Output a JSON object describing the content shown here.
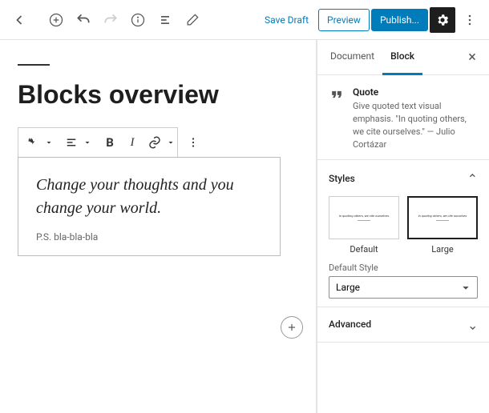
{
  "topbar": {
    "save_draft": "Save Draft",
    "preview": "Preview",
    "publish": "Publish..."
  },
  "editor": {
    "post_title": "Blocks overview",
    "quote": {
      "text": "Change your thoughts and you change your world.",
      "citation": "P.S. bla-bla-bla"
    },
    "toolbar": {
      "bold": "B",
      "italic": "I"
    }
  },
  "sidebar": {
    "tabs": {
      "document": "Document",
      "block": "Block"
    },
    "block_info": {
      "title": "Quote",
      "description": "Give quoted text visual emphasis. \"In quoting others, we cite ourselves.\" — Julio Cortázar"
    },
    "styles": {
      "heading": "Styles",
      "options": [
        "Default",
        "Large"
      ],
      "selected": "Large",
      "default_style_label": "Default Style",
      "default_style_value": "Large",
      "preview_text": "In quoting others, we cite ourselves"
    },
    "advanced": "Advanced"
  }
}
